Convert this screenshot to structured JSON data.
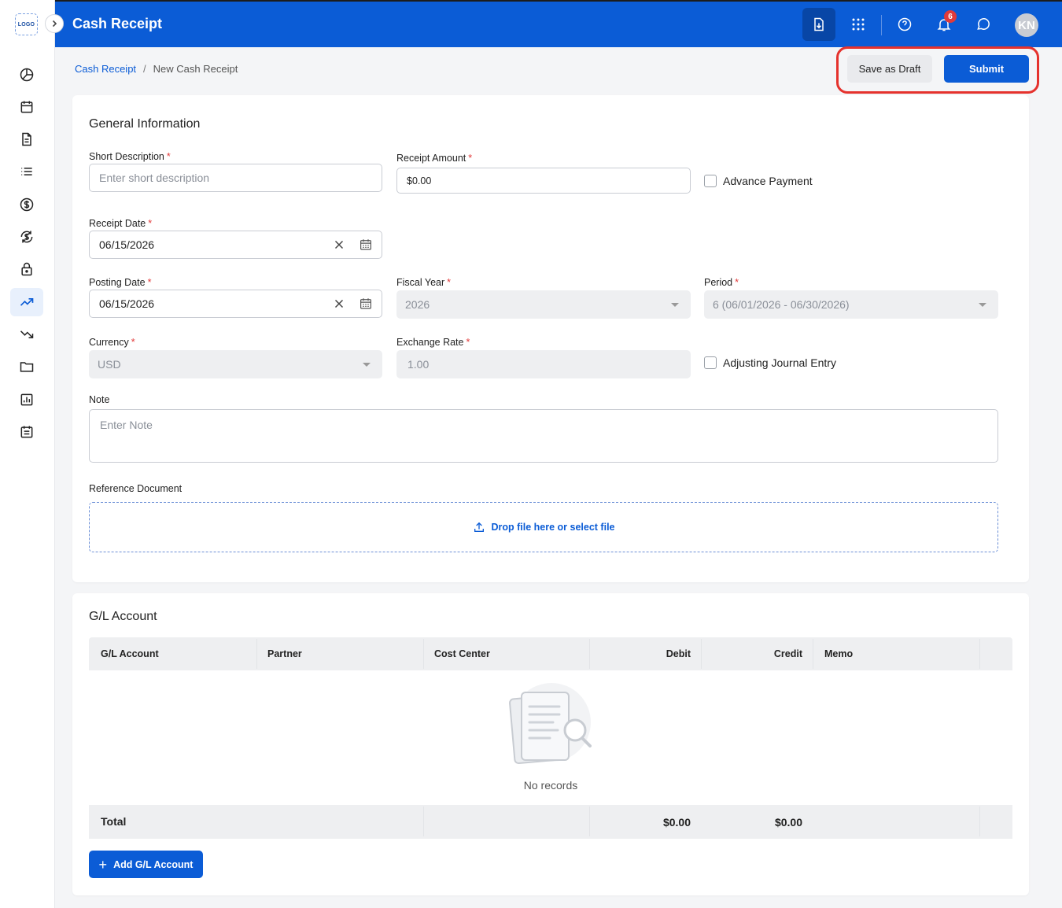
{
  "app": {
    "logo_text": "LOGO",
    "title": "Cash Receipt",
    "notification_count": "6",
    "avatar_initials": "KN"
  },
  "sidebar": {
    "items": [
      {
        "icon": "pie-chart-icon"
      },
      {
        "icon": "calendar-icon"
      },
      {
        "icon": "document-icon"
      },
      {
        "icon": "list-icon"
      },
      {
        "icon": "dollar-icon"
      },
      {
        "icon": "dollar-cycle-icon"
      },
      {
        "icon": "lock-icon"
      },
      {
        "icon": "trending-up-icon",
        "active": true
      },
      {
        "icon": "trending-down-icon"
      },
      {
        "icon": "folder-icon"
      },
      {
        "icon": "report-chart-icon"
      },
      {
        "icon": "calendar-list-icon"
      }
    ]
  },
  "breadcrumb": {
    "parent": "Cash Receipt",
    "separator": "/",
    "current": "New Cash Receipt"
  },
  "actions": {
    "save_draft": "Save as Draft",
    "submit": "Submit"
  },
  "general": {
    "title": "General Information",
    "short_description": {
      "label": "Short Description",
      "placeholder": "Enter short description"
    },
    "receipt_amount": {
      "label": "Receipt Amount",
      "value": "$0.00"
    },
    "advance_payment": {
      "label": "Advance Payment"
    },
    "receipt_date": {
      "label": "Receipt Date",
      "value": "06/15/2026"
    },
    "posting_date": {
      "label": "Posting Date",
      "value": "06/15/2026"
    },
    "fiscal_year": {
      "label": "Fiscal Year",
      "value": "2026"
    },
    "period": {
      "label": "Period",
      "value": "6 (06/01/2026 - 06/30/2026)"
    },
    "currency": {
      "label": "Currency",
      "value": "USD"
    },
    "exchange_rate": {
      "label": "Exchange Rate",
      "value": "1.00"
    },
    "adjusting_journal_entry": {
      "label": "Adjusting Journal Entry"
    },
    "note": {
      "label": "Note",
      "placeholder": "Enter Note"
    },
    "reference_document": {
      "label": "Reference Document",
      "dropzone_text": "Drop file here or select file"
    }
  },
  "gl": {
    "title": "G/L Account",
    "columns": [
      "G/L Account",
      "Partner",
      "Cost Center",
      "Debit",
      "Credit",
      "Memo"
    ],
    "empty_text": "No records",
    "total_label": "Total",
    "total_debit": "$0.00",
    "total_credit": "$0.00",
    "add_button": "Add G/L Account"
  },
  "colors": {
    "primary": "#0b5cd6",
    "required": "#e23a3a",
    "highlight": "#e5322d"
  }
}
